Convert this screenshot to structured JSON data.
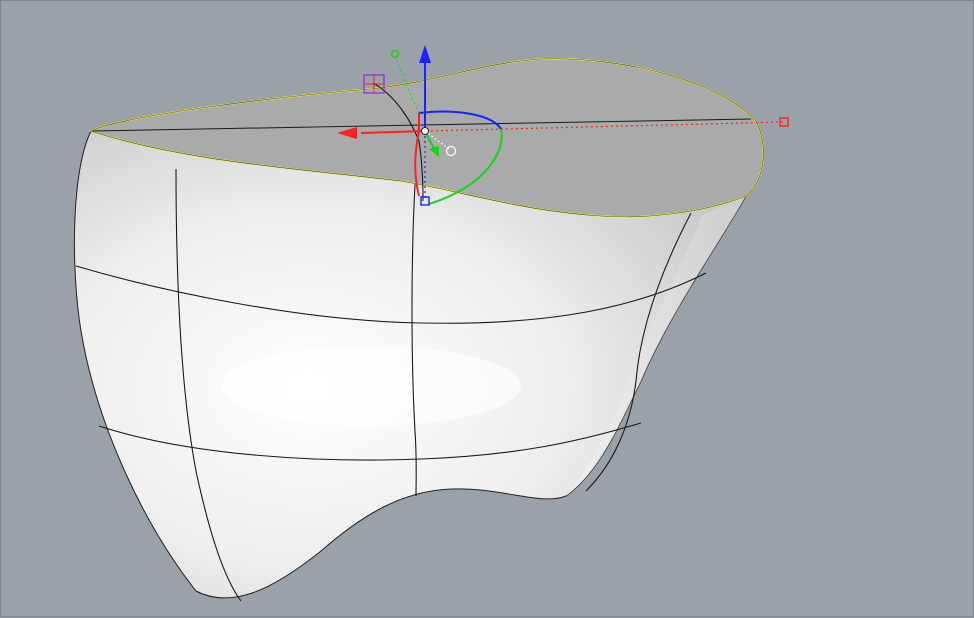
{
  "viewport": {
    "background": "#9aa1a9",
    "view": "perspective"
  },
  "model": {
    "surface_color": "#f2f2f2",
    "top_face_color": "#a9aaaa",
    "selected_edge_color": "#ffff3a",
    "isocurve_color": "#1a1a1a"
  },
  "gumball": {
    "x_axis_color": "#ff2020",
    "y_axis_color": "#19d21e",
    "z_axis_color": "#1a22ff",
    "icons": [
      "move-x-arrow-icon",
      "move-z-arrow-icon",
      "rotate-handle-icon",
      "scale-handle-icon",
      "gumball-origin-icon"
    ]
  }
}
